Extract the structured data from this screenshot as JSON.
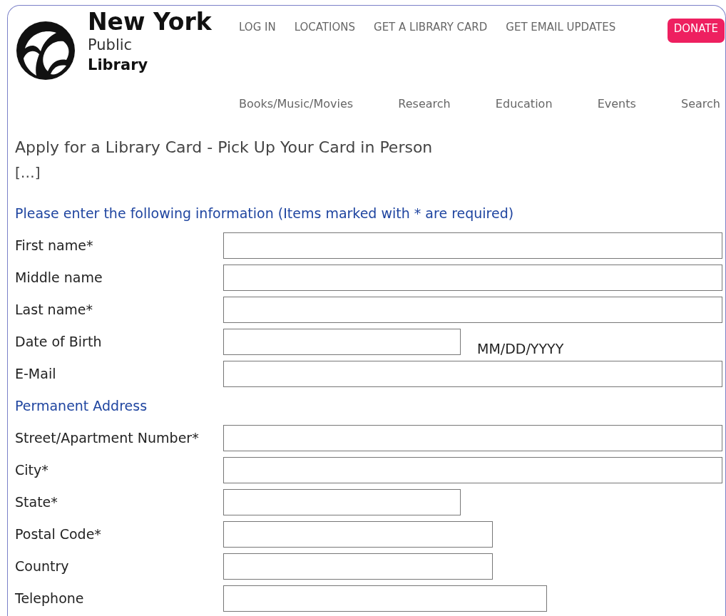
{
  "logo": {
    "line1": "New York",
    "line2": "Public",
    "line3": "Library"
  },
  "top_links": [
    "LOG IN",
    "LOCATIONS",
    "GET A LIBRARY CARD",
    "GET EMAIL UPDATES"
  ],
  "donate_button": "DONATE",
  "nav": [
    "Books/Music/Movies",
    "Research",
    "Education",
    "Events",
    "Search"
  ],
  "page_title": "Apply for a Library Card - Pick Up Your Card in Person",
  "ellipsis": "[…]",
  "sections": [
    {
      "heading": "Please enter the following information (Items marked with * are required)",
      "fields": [
        {
          "label": "First name*",
          "kind": "full"
        },
        {
          "label": "Middle name",
          "kind": "full"
        },
        {
          "label": "Last name*",
          "kind": "full"
        },
        {
          "label": "Date of Birth",
          "kind": "half",
          "hint": "MM/DD/YYYY"
        },
        {
          "label": "E-Mail",
          "kind": "full"
        }
      ]
    },
    {
      "heading": "Permanent Address",
      "fields": [
        {
          "label": "Street/Apartment Number*",
          "kind": "full"
        },
        {
          "label": "City*",
          "kind": "full"
        },
        {
          "label": "State*",
          "kind": "half"
        },
        {
          "label": "Postal Code*",
          "kind": "medium"
        },
        {
          "label": "Country",
          "kind": "medium"
        },
        {
          "label": "Telephone",
          "kind": "long"
        }
      ]
    }
  ]
}
